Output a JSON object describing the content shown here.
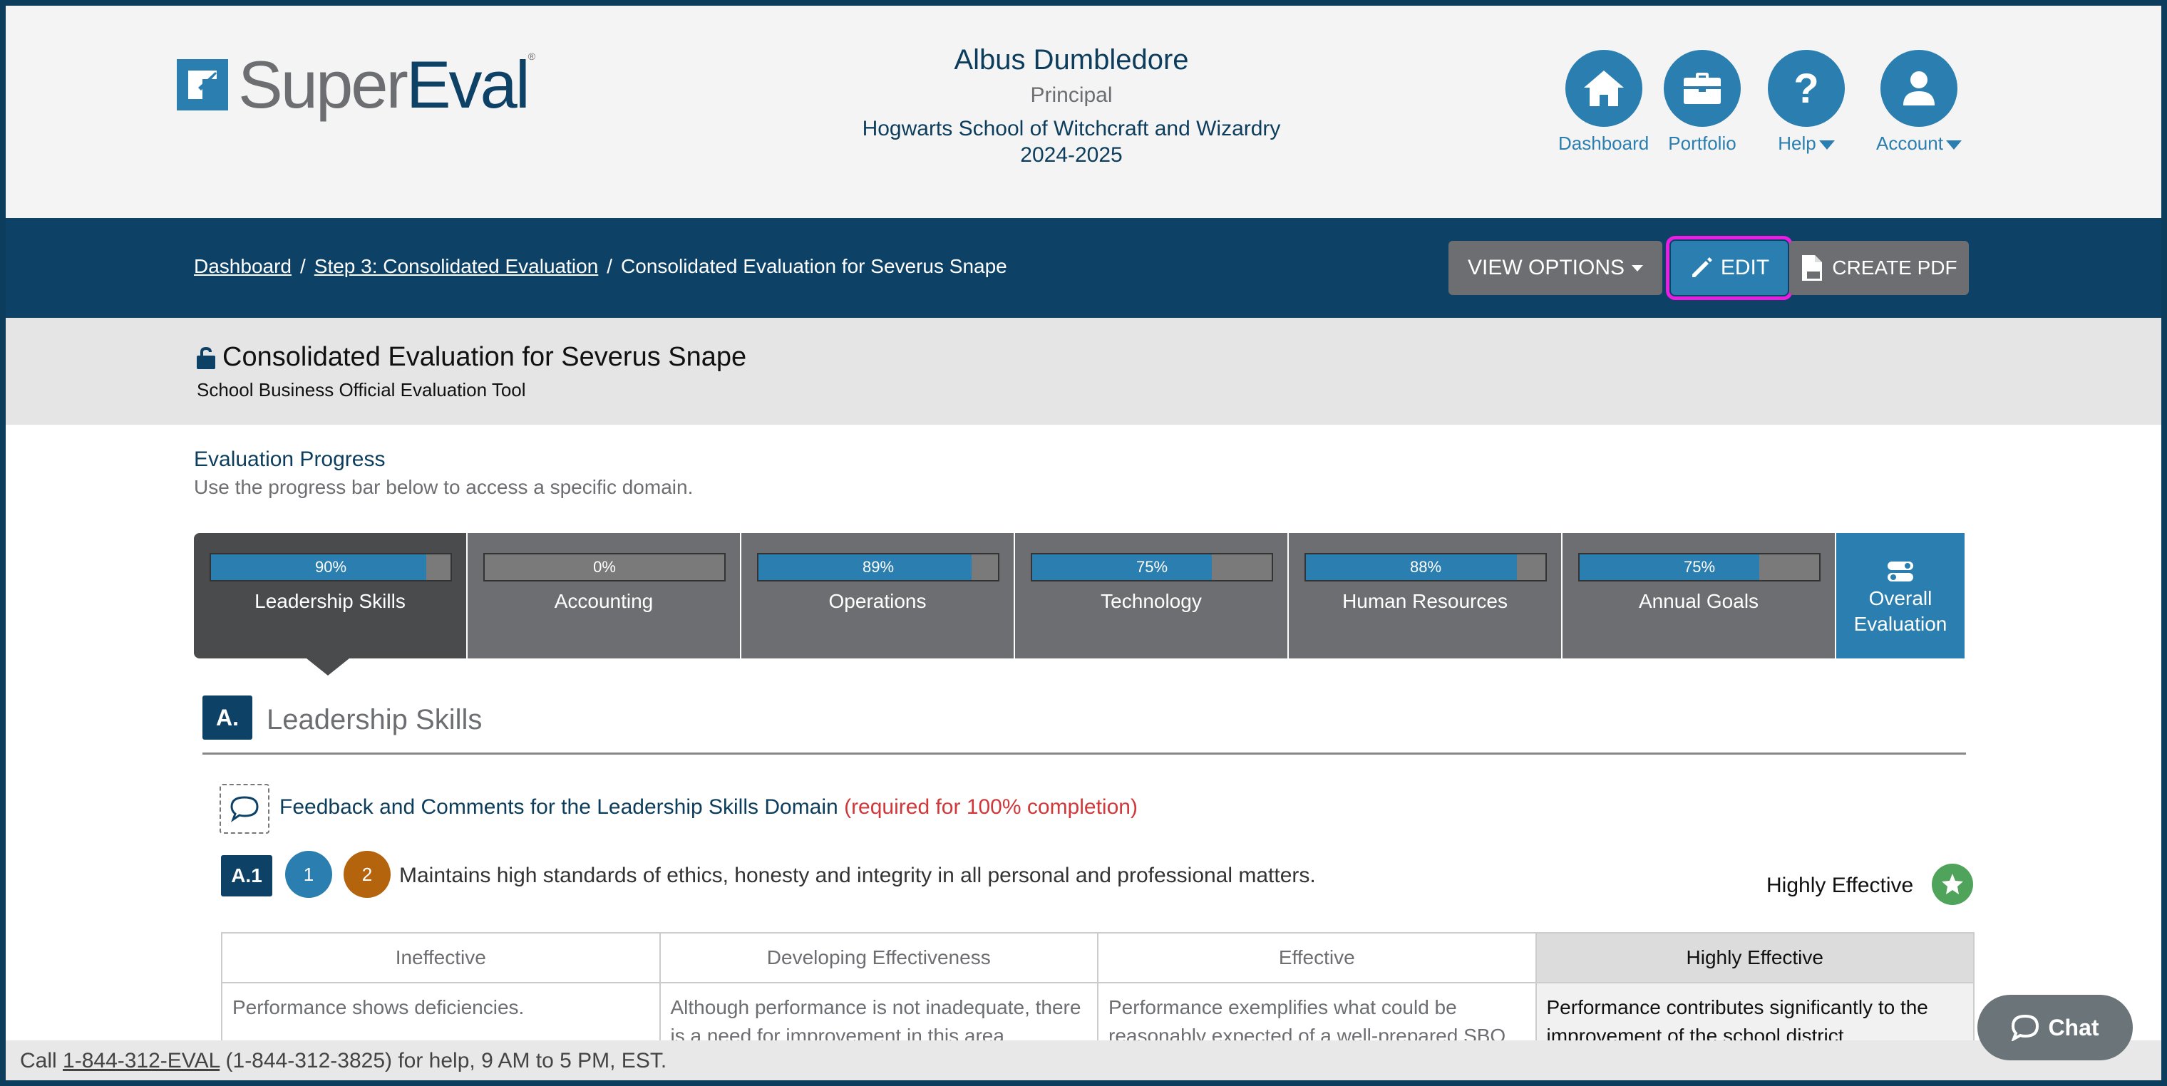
{
  "brand": {
    "super": "Super",
    "eval": "Eval",
    "reg": "®"
  },
  "user": {
    "name": "Albus Dumbledore",
    "role": "Principal",
    "school": "Hogwarts School of Witchcraft and Wizardry",
    "year": "2024-2025"
  },
  "nav": {
    "dashboard": "Dashboard",
    "portfolio": "Portfolio",
    "help": "Help",
    "account": "Account"
  },
  "breadcrumb": {
    "items": [
      "Dashboard",
      "Step 3: Consolidated Evaluation",
      "Consolidated Evaluation for Severus Snape"
    ],
    "separator": "/"
  },
  "toolbar": {
    "view_options": "VIEW OPTIONS",
    "edit": "EDIT",
    "create_pdf": "CREATE PDF"
  },
  "page": {
    "title": "Consolidated Evaluation for Severus Snape",
    "subtitle": "School Business Official Evaluation Tool"
  },
  "progress": {
    "heading": "Evaluation Progress",
    "description": "Use the progress bar below to access a specific domain.",
    "domains": [
      {
        "name": "Leadership Skills",
        "percent": 90,
        "label": "90%"
      },
      {
        "name": "Accounting",
        "percent": 0,
        "label": "0%"
      },
      {
        "name": "Operations",
        "percent": 89,
        "label": "89%"
      },
      {
        "name": "Technology",
        "percent": 75,
        "label": "75%"
      },
      {
        "name": "Human Resources",
        "percent": 88,
        "label": "88%"
      },
      {
        "name": "Annual Goals",
        "percent": 75,
        "label": "75%"
      }
    ],
    "overall": {
      "line1": "Overall",
      "line2": "Evaluation"
    }
  },
  "section": {
    "letter": "A.",
    "title": "Leadership Skills",
    "feedback_text": "Feedback and Comments for the Leadership Skills Domain",
    "feedback_required": "(required for 100% completion)"
  },
  "standard": {
    "code": "A.1",
    "circle1": "1",
    "circle2": "2",
    "text": "Maintains high standards of ethics, honesty and integrity in all personal and professional matters.",
    "rating": "Highly Effective"
  },
  "rubric": {
    "headers": [
      "Ineffective",
      "Developing Effectiveness",
      "Effective",
      "Highly Effective"
    ],
    "cells": [
      "Performance shows deficiencies.",
      "Although performance is not inadequate, there is a need for improvement in this area.",
      "Performance exemplifies what could be reasonably expected of a well-prepared SBO.",
      "Performance contributes significantly to the improvement of the school district."
    ]
  },
  "footer": {
    "prefix": "Call",
    "phone_link": "1-844-312-EVAL",
    "suffix": "(1-844-312-3825) for help, 9 AM to 5 PM, EST."
  },
  "chat": {
    "label": "Chat"
  },
  "colors": {
    "primary": "#0d4166",
    "accent": "#2a7fb0",
    "gray": "#6d6e71",
    "highlight": "#e81ee0",
    "required": "#d0383a",
    "success": "#4fa35a"
  }
}
